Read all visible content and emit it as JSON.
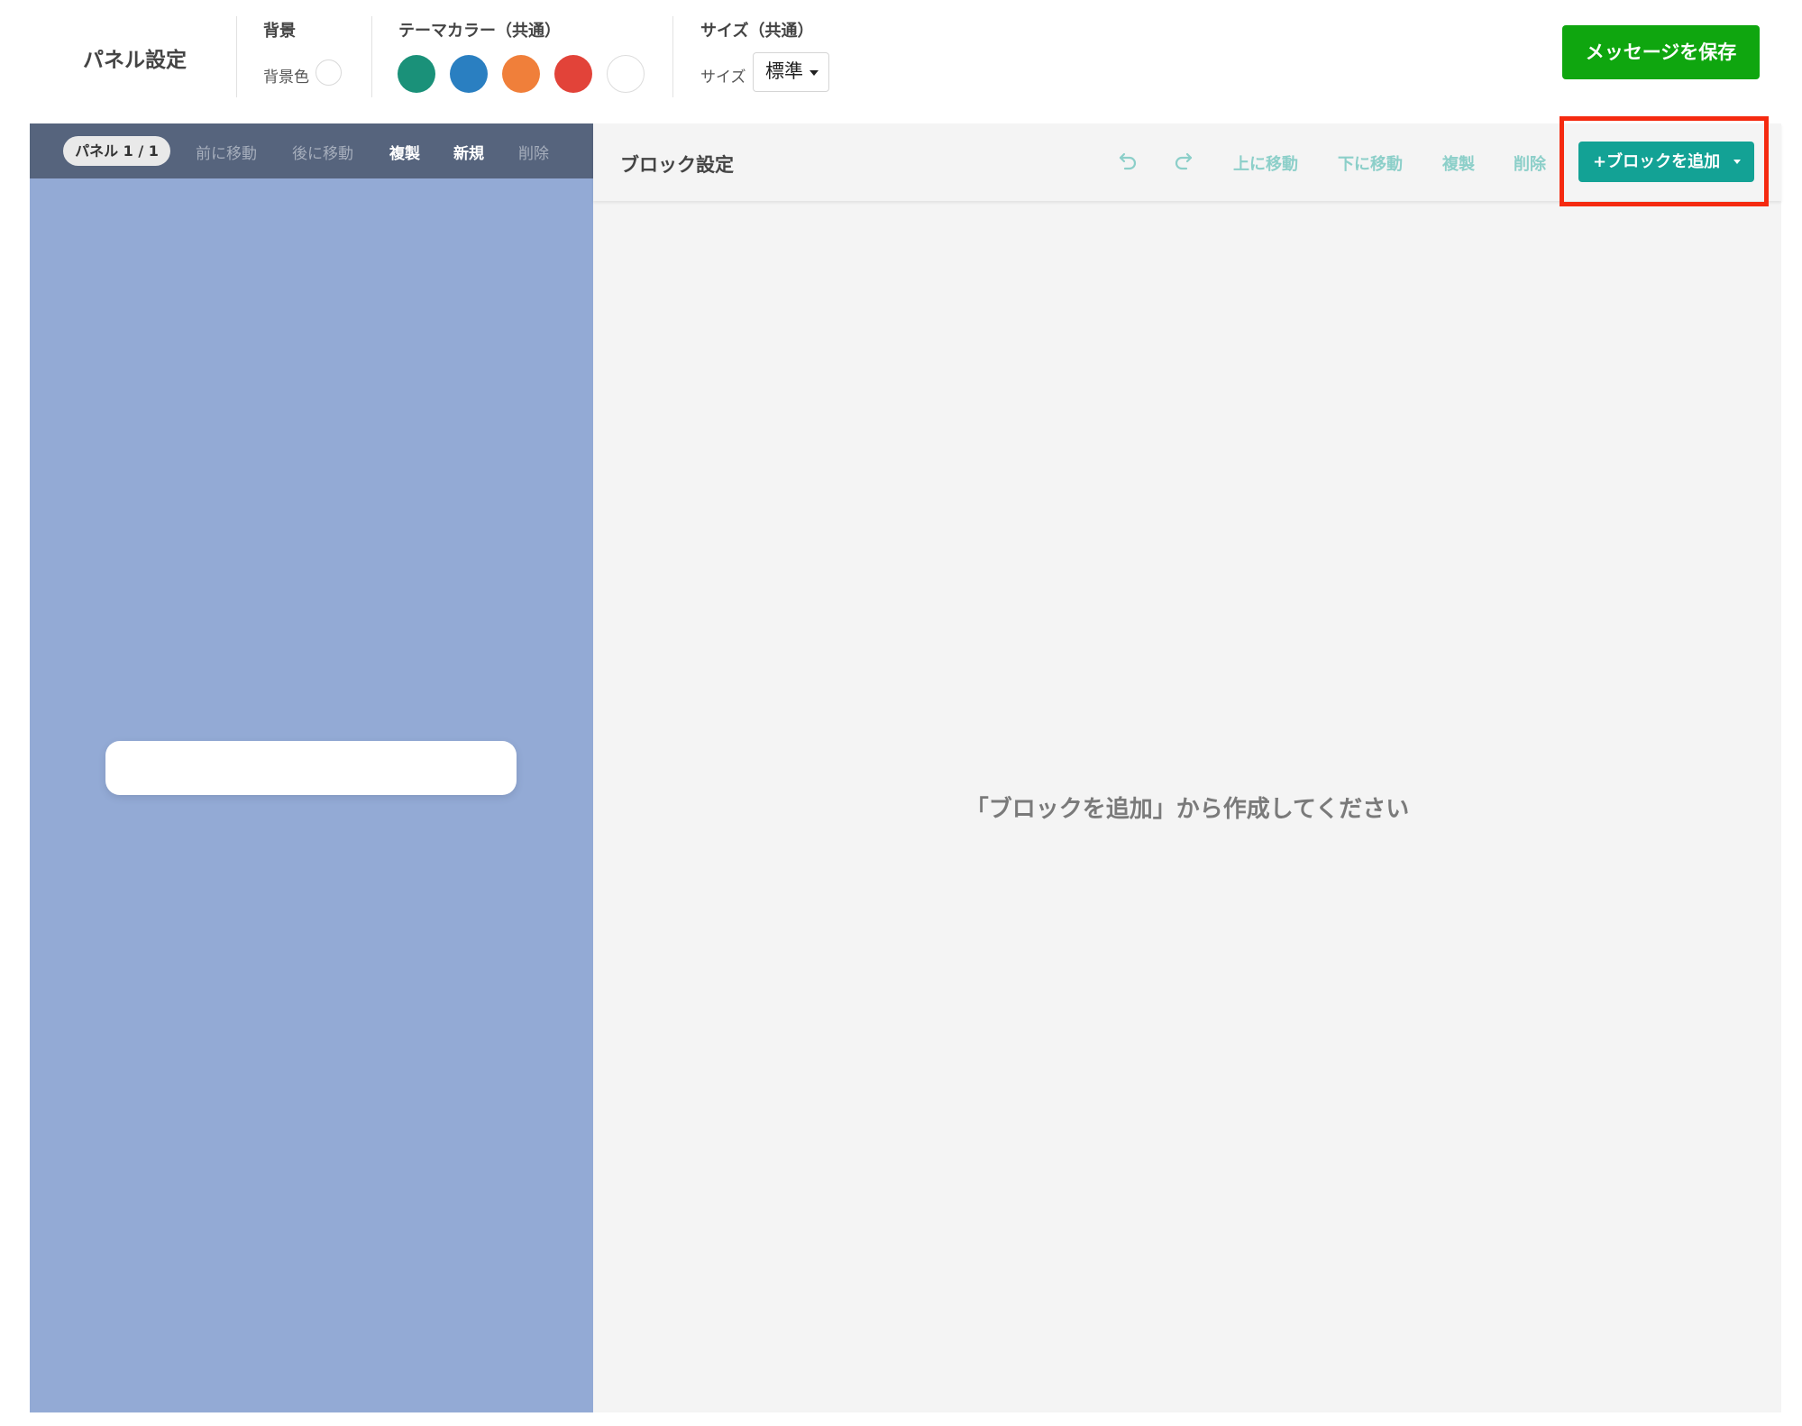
{
  "header": {
    "title": "パネル設定",
    "background": {
      "label": "背景",
      "color_label": "背景色",
      "color": "#ffffff"
    },
    "theme": {
      "label": "テーマカラー（共通）",
      "colors": [
        "#1a9179",
        "#2a7fc1",
        "#f07f3a",
        "#e24339",
        "#ffffff"
      ]
    },
    "size": {
      "label": "サイズ（共通）",
      "field_label": "サイズ",
      "selected": "標準"
    },
    "save_label": "メッセージを保存"
  },
  "left_panel": {
    "badge": "パネル 1 / 1",
    "actions": {
      "move_prev": "前に移動",
      "move_next": "後に移動",
      "duplicate": "複製",
      "new": "新規",
      "delete": "削除"
    },
    "background_color": "#93aad5"
  },
  "editor": {
    "title": "ブロック設定",
    "undo_icon": "undo-icon",
    "redo_icon": "redo-icon",
    "actions": {
      "move_up": "上に移動",
      "move_down": "下に移動",
      "duplicate": "複製",
      "delete": "削除"
    },
    "add_block_label": "+ブロックを追加",
    "empty_message": "「ブロックを追加」から作成してください"
  },
  "colors": {
    "save_button": "#0fa60f",
    "add_block_button": "#13a295",
    "highlight": "#f52a10"
  }
}
